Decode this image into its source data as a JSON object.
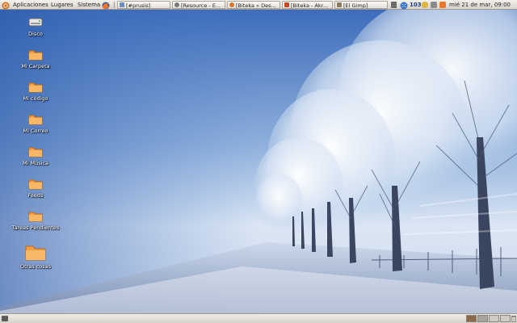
{
  "top_panel": {
    "menus": [
      "Aplicaciones",
      "Lugares",
      "Sistema"
    ],
    "tasks": [
      {
        "label": "[#prusis]",
        "icon_color": "#6b8fbf"
      },
      {
        "label": "[Resource - E...",
        "icon_color": "#7a7a7a"
      },
      {
        "label": "[Biteka » Des...",
        "icon_color": "#d9762a"
      },
      {
        "label": "[Biteka - Akr...",
        "icon_color": "#c44a2a"
      },
      {
        "label": "[El Gimp]",
        "icon_color": "#8a7a5a"
      }
    ],
    "tray": {
      "network_count": "103",
      "clock": "mié 21 de mar, 09:00"
    }
  },
  "desktop": {
    "icons": [
      {
        "label": "Disco",
        "icon": "drive-icon"
      },
      {
        "label": "Mi Carpeta",
        "icon": "folder-icon"
      },
      {
        "label": "Mi código",
        "icon": "folder-icon"
      },
      {
        "label": "Mi Correo",
        "icon": "folder-icon"
      },
      {
        "label": "Mi Música",
        "icon": "folder-icon"
      },
      {
        "label": "Feeds",
        "icon": "folder-icon"
      },
      {
        "label": "Tareas Pendientes",
        "icon": "folder-icon"
      },
      {
        "label": "Otras cosas",
        "icon": "folder-icon"
      }
    ]
  },
  "bottom_panel": {
    "workspaces": [
      "#8a6a4a",
      "#a8a39a",
      "#cfcbc2",
      "#d0ccc3"
    ]
  },
  "colors": {
    "folder": "#f0a04a",
    "sky_top": "#3d6fbf",
    "sky_bottom": "#e8eff8"
  }
}
